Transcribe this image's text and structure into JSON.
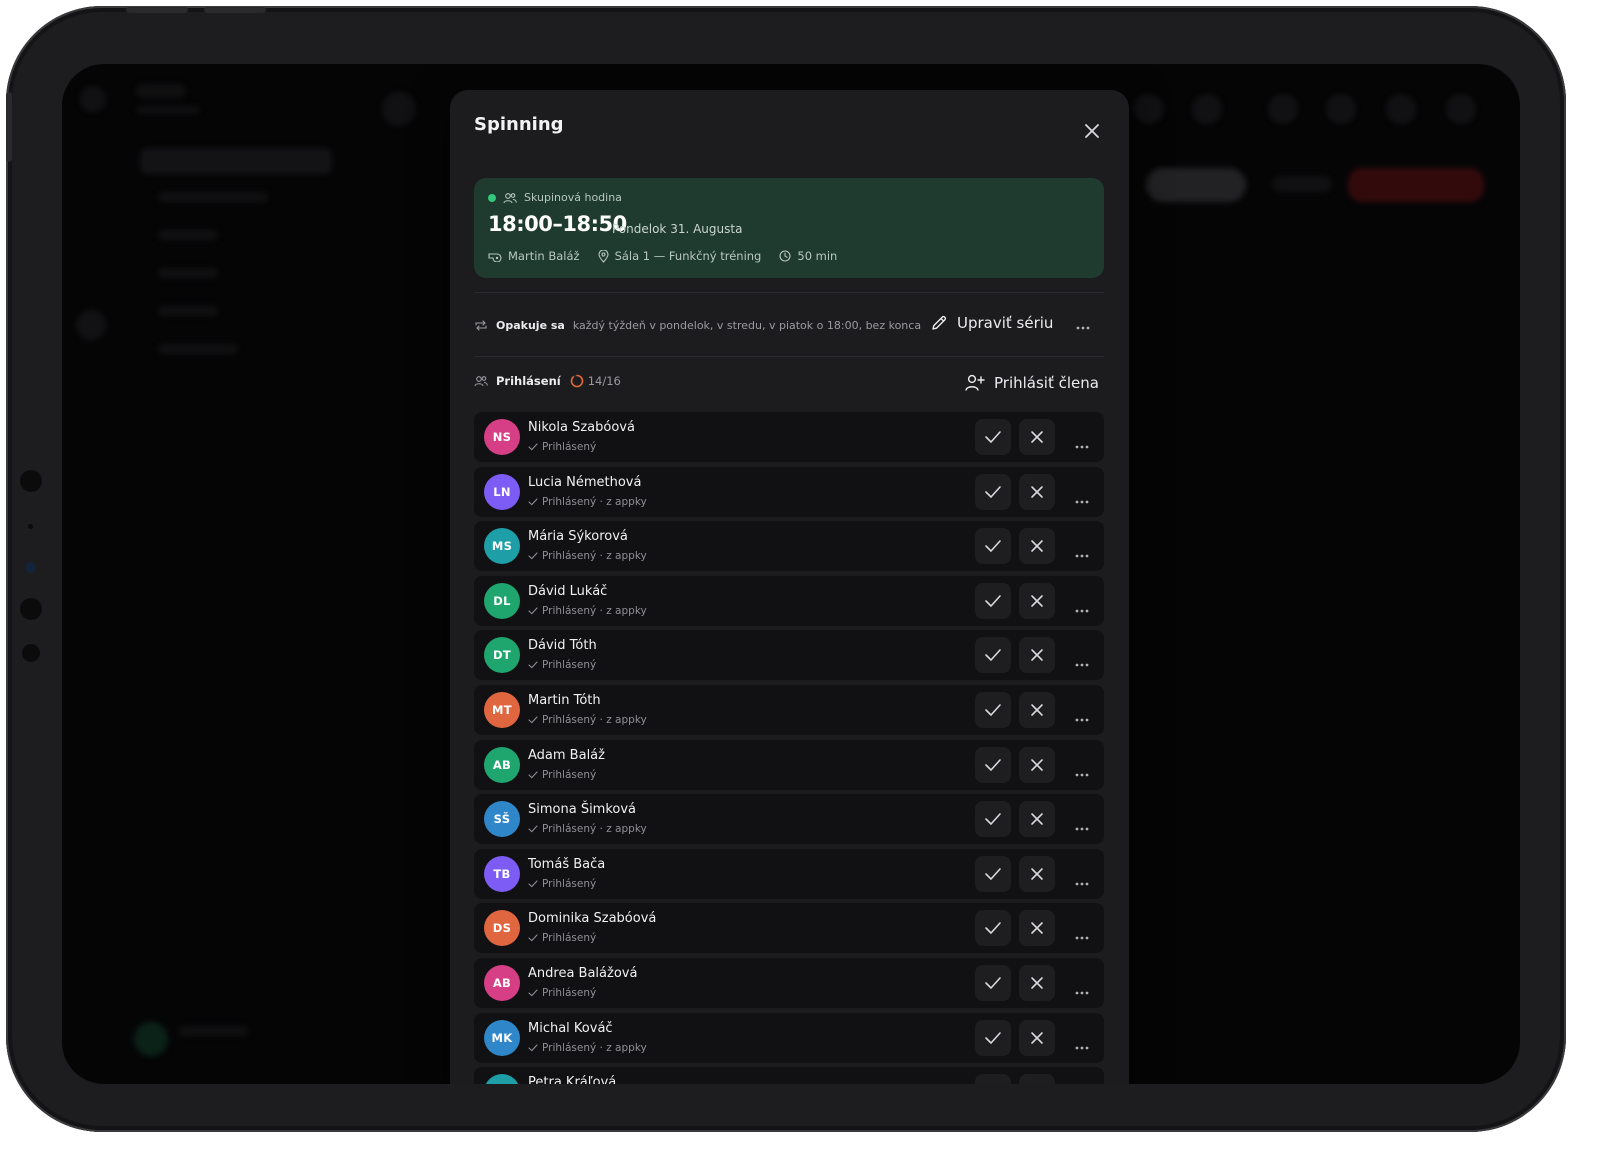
{
  "modal": {
    "title": "Spinning"
  },
  "event": {
    "type": "Skupinová hodina",
    "time": "18:00–18:50",
    "date": "Pondelok 31. Augusta",
    "trainer": "Martin Baláž",
    "room": "Sála 1 — Funkčný tréning",
    "duration": "50 min",
    "accent": "#34c77b",
    "card_bg": "#1f3a2e"
  },
  "recurrence": {
    "label": "Opakuje sa",
    "text": "každý týždeň v pondelok, v stredu, v piatok o 18:00, bez konca",
    "edit_label": "Upraviť sériu"
  },
  "attendance": {
    "label": "Prihlásení",
    "count": "14/16",
    "registered": 14,
    "capacity": 16,
    "add_label": "Prihlásiť člena"
  },
  "members": [
    {
      "initials": "NS",
      "name": "Nikola Szabóová",
      "status": "Prihlásený",
      "color": "#d63f86"
    },
    {
      "initials": "LN",
      "name": "Lucia Némethová",
      "status": "Prihlásený · z appky",
      "color": "#7c5cf5"
    },
    {
      "initials": "MS",
      "name": "Mária Sýkorová",
      "status": "Prihlásený · z appky",
      "color": "#1e9fa8"
    },
    {
      "initials": "DL",
      "name": "Dávid Lukáč",
      "status": "Prihlásený · z appky",
      "color": "#1fa56e"
    },
    {
      "initials": "DT",
      "name": "Dávid Tóth",
      "status": "Prihlásený",
      "color": "#1fa56e"
    },
    {
      "initials": "MT",
      "name": "Martin Tóth",
      "status": "Prihlásený · z appky",
      "color": "#e06640"
    },
    {
      "initials": "AB",
      "name": "Adam Baláž",
      "status": "Prihlásený",
      "color": "#1fa56e"
    },
    {
      "initials": "SŠ",
      "name": "Simona Šimková",
      "status": "Prihlásený · z appky",
      "color": "#2f86c9"
    },
    {
      "initials": "TB",
      "name": "Tomáš Bača",
      "status": "Prihlásený",
      "color": "#7c5cf5"
    },
    {
      "initials": "DS",
      "name": "Dominika Szabóová",
      "status": "Prihlásený",
      "color": "#e06640"
    },
    {
      "initials": "AB",
      "name": "Andrea Balážová",
      "status": "Prihlásený",
      "color": "#d63f86"
    },
    {
      "initials": "MK",
      "name": "Michal Kováč",
      "status": "Prihlásený · z appky",
      "color": "#2f86c9"
    },
    {
      "initials": "",
      "name": "Petra Kráľová",
      "status": "",
      "color": "#1e9fa8"
    }
  ]
}
